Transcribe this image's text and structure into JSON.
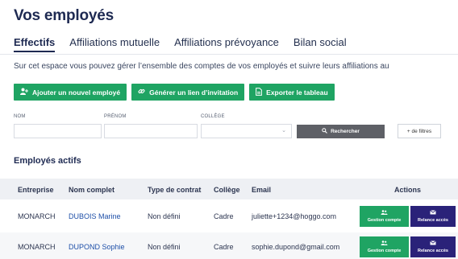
{
  "page": {
    "title": "Vos employés"
  },
  "tabs": [
    {
      "label": "Effectifs",
      "active": true
    },
    {
      "label": "Affiliations mutuelle",
      "active": false
    },
    {
      "label": "Affiliations prévoyance",
      "active": false
    },
    {
      "label": "Bilan social",
      "active": false
    }
  ],
  "intro": "Sur cet espace vous pouvez gérer l’ensemble des comptes de vos employés et suivre leurs affiliations au",
  "actions": {
    "add_employee": {
      "label": "Ajouter un nouvel employé",
      "icon": "user-plus-icon"
    },
    "invite_link": {
      "label": "Générer un lien d’invitation",
      "icon": "link-icon"
    },
    "export": {
      "label": "Exporter le tableau",
      "icon": "document-icon"
    }
  },
  "filters": {
    "nom": {
      "label": "NOM",
      "value": "",
      "placeholder": ""
    },
    "prenom": {
      "label": "PRÉNOM",
      "value": "",
      "placeholder": ""
    },
    "college": {
      "label": "COLLÈGE",
      "value": ""
    },
    "search_label": "Rechercher",
    "more_filters_label": "+ de filtres"
  },
  "active_section": {
    "title": "Employés actifs"
  },
  "table": {
    "columns": [
      "Entreprise",
      "Nom complet",
      "Type de contrat",
      "Collège",
      "Email",
      "Actions"
    ],
    "rows": [
      {
        "entreprise": "MONARCH",
        "nom_complet": "DUBOIS Marine",
        "type_contrat": "Non défini",
        "college": "Cadre",
        "email": "juliette+1234@hoggo.com",
        "action_account": "Gestion compte",
        "action_reminder": "Relance accès"
      },
      {
        "entreprise": "MONARCH",
        "nom_complet": "DUPOND Sophie",
        "type_contrat": "Non défini",
        "college": "Cadre",
        "email": "sophie.dupond@gmail.com",
        "action_account": "Gestion compte",
        "action_reminder": "Relance accès"
      }
    ]
  },
  "colors": {
    "primary_green": "#1fa463",
    "navy": "#2a2279",
    "title": "#1e2a52",
    "search_button": "#5e6066"
  }
}
